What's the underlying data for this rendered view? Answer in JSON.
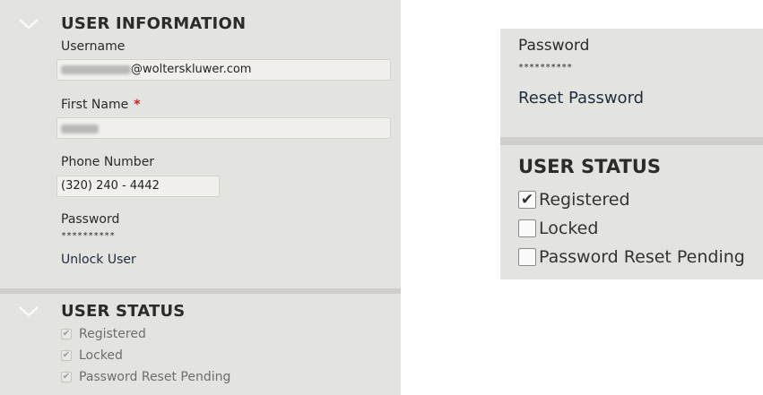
{
  "left_panel": {
    "user_information": {
      "title": "USER INFORMATION",
      "username": {
        "label": "Username",
        "value_suffix": "@wolterskluwer.com"
      },
      "first_name": {
        "label": "First Name",
        "required_mark": "*"
      },
      "phone": {
        "label": "Phone Number",
        "value": "(320) 240 - 4442"
      },
      "password": {
        "label": "Password",
        "mask": "**********"
      },
      "unlock_link": "Unlock User"
    },
    "user_status": {
      "title": "USER STATUS",
      "items": [
        {
          "label": "Registered",
          "checked": true,
          "disabled": true
        },
        {
          "label": "Locked",
          "checked": true,
          "disabled": true
        },
        {
          "label": "Password Reset Pending",
          "checked": true,
          "disabled": true
        }
      ]
    }
  },
  "right_panel": {
    "password": {
      "label": "Password",
      "mask": "**********"
    },
    "reset_link": "Reset Password",
    "user_status": {
      "title": "USER STATUS",
      "items": [
        {
          "label": "Registered",
          "checked": true
        },
        {
          "label": "Locked",
          "checked": false
        },
        {
          "label": "Password Reset Pending",
          "checked": false
        }
      ]
    }
  },
  "icons": {
    "collapse": "chevron-down-icon",
    "check": "checkmark-icon"
  },
  "colors": {
    "panel_bg": "#e3e3e0",
    "link": "#1f2b3f",
    "required": "#d42020"
  }
}
